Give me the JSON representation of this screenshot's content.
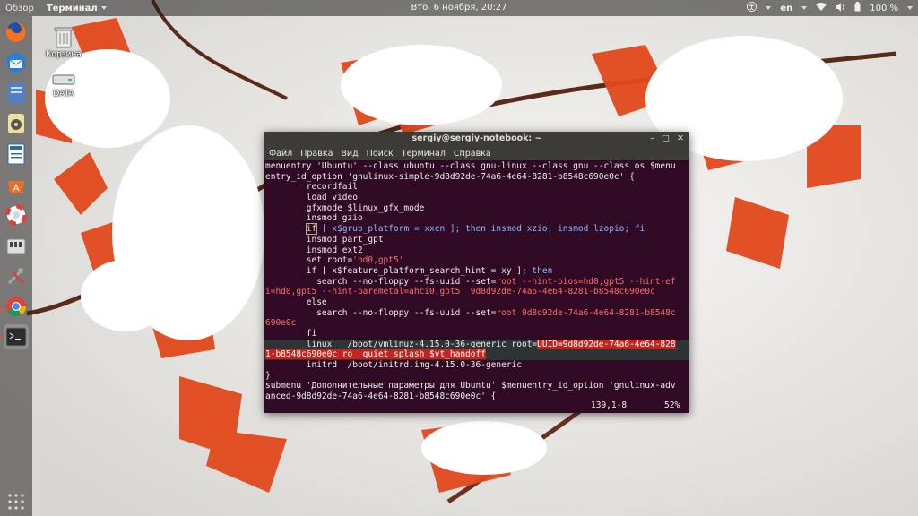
{
  "topbar": {
    "activities": "Обзор",
    "app_name": "Терминал",
    "clock": "Вто, 6 ноября, 20:27",
    "language": "en",
    "battery": "100 %"
  },
  "dock": {
    "items": [
      "firefox-icon",
      "thunderbird-icon",
      "files-icon",
      "rhythmbox-icon",
      "writer-icon",
      "software-center-icon",
      "help-icon",
      "usb-disk-icon",
      "settings-icon",
      "chrome-icon",
      "terminal-icon"
    ]
  },
  "desktop": {
    "trash_label": "Корзина",
    "drive_label": "DATA"
  },
  "terminal": {
    "title": "sergiy@sergiy-notebook: ~",
    "menu": [
      "Файл",
      "Правка",
      "Вид",
      "Поиск",
      "Терминал",
      "Справка"
    ],
    "lines": {
      "l1": "menuentry 'Ubuntu' --class ubuntu --class gnu-linux --class gnu --class os $menu",
      "l2": "entry_id_option 'gnulinux-simple-9d8d92de-74a6-4e64-8281-b8548c690e0c' {",
      "l3": "        recordfail",
      "l4": "        load_video",
      "l5": "        gfxmode $linux_gfx_mode",
      "l6": "        insmod gzio",
      "l7a": "        ",
      "l7b": "if",
      "l7c": " [ x$grub_platform = xxen ]; then insmod xzio; insmod lzopio; fi",
      "l8": "        insmod part_gpt",
      "l9": "        insmod ext2",
      "l10a": "        set root=",
      "l10b": "'hd0,gpt5'",
      "l11a": "        if [ x$feature_platform_search_hint = xy ]; ",
      "l11b": "then",
      "l12a": "          search --no-floppy --fs-uuid --set=",
      "l12b": "root --hint-bios=hd0,gpt5 --hint-ef",
      "l13": "i=hd0,gpt5 --hint-baremetal=ahci0,gpt5  9d8d92de-74a6-4e64-8281-b8548c690e0c",
      "l14": "        else",
      "l15a": "          search --no-floppy --fs-uuid --set=",
      "l15b": "root 9d8d92de-74a6-4e64-8281-b8548c",
      "l16": "690e0c",
      "l17": "        fi",
      "l18a": "        linux   /boot/vmlinuz-4.15.0-36-generic root=",
      "l18b": "UUID=9d8d92de-74a6-4e64-828",
      "l19": "1-b8548c690e0c ro  quiet splash $vt_handoff",
      "l20": "        initrd  /boot/initrd.img-4.15.0-36-generic",
      "l21": "}",
      "l22": "submenu 'Дополнительные параметры для Ubuntu' $menuentry_id_option 'gnulinux-adv",
      "l23": "anced-9d8d92de-74a6-4e64-8281-b8548c690e0c' {"
    },
    "status_position": "139,1-8",
    "status_percent": "52%"
  },
  "colors": {
    "terminal_bg": "#300a24",
    "highlight": "#c4241e",
    "keyword": "#8fb8ff"
  }
}
